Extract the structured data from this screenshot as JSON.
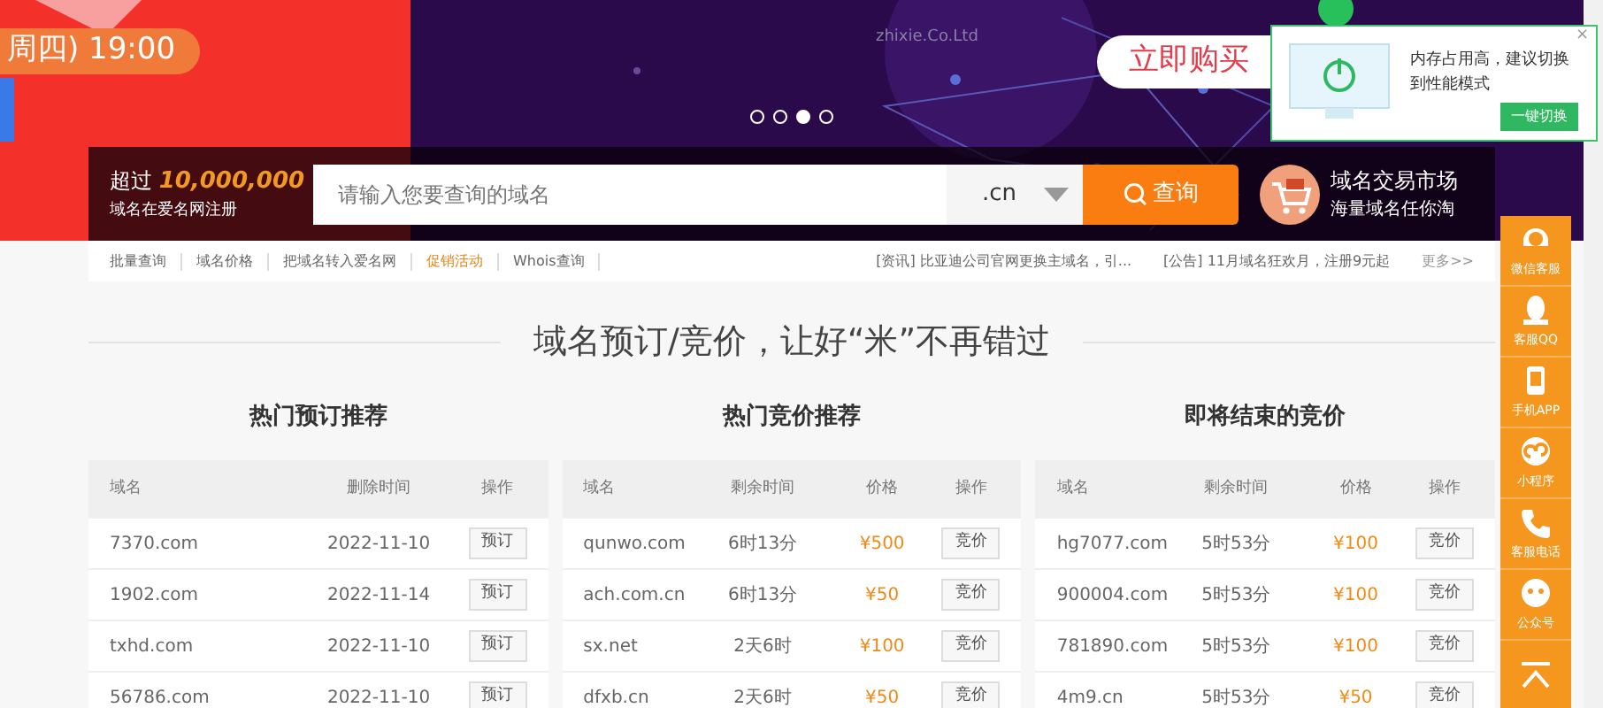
{
  "banner": {
    "promo_time": "周四) 19:00",
    "company": "zhixie.Co.Ltd",
    "buy_button": "立即购买",
    "dots": [
      {
        "selected": false
      },
      {
        "selected": false
      },
      {
        "selected": true
      },
      {
        "selected": false
      }
    ]
  },
  "search": {
    "stat_prefix": "超过",
    "stat_number": "10,000,000",
    "stat_caption": "域名在爱名网注册",
    "placeholder": "请输入您要查询的域名",
    "suffix": ".cn",
    "button": "查询",
    "market_title": "域名交易市场",
    "market_caption": "海量域名任你淘"
  },
  "quick_links": [
    {
      "label": "批量查询",
      "highlight": false
    },
    {
      "label": "域名价格",
      "highlight": false
    },
    {
      "label": "把域名转入爱名网",
      "highlight": false
    },
    {
      "label": "促销活动",
      "highlight": true
    },
    {
      "label": "Whois查询",
      "highlight": false
    }
  ],
  "news": [
    {
      "tag": "[资讯]",
      "text": "比亚迪公司官网更换主域名，引..."
    },
    {
      "tag": "[公告]",
      "text": "11月域名狂欢月，注册9元起"
    }
  ],
  "more": "更多>>",
  "heading": "域名预订/竞价，让好“米”不再错过",
  "tables": [
    {
      "title": "热门预订推荐",
      "columns": [
        "域名",
        "删除时间",
        "操作"
      ],
      "rows": [
        {
          "cells": [
            "7370.com",
            "2022-11-10"
          ],
          "action": "预订"
        },
        {
          "cells": [
            "1902.com",
            "2022-11-14"
          ],
          "action": "预订"
        },
        {
          "cells": [
            "txhd.com",
            "2022-11-10"
          ],
          "action": "预订"
        },
        {
          "cells": [
            "56786.com",
            "2022-11-10"
          ],
          "action": "预订"
        }
      ]
    },
    {
      "title": "热门竞价推荐",
      "columns": [
        "域名",
        "剩余时间",
        "价格",
        "操作"
      ],
      "rows": [
        {
          "cells": [
            "qunwo.com",
            "6时13分",
            "¥500"
          ],
          "action": "竞价"
        },
        {
          "cells": [
            "ach.com.cn",
            "6时13分",
            "¥50"
          ],
          "action": "竞价"
        },
        {
          "cells": [
            "sx.net",
            "2天6时",
            "¥100"
          ],
          "action": "竞价"
        },
        {
          "cells": [
            "dfxb.cn",
            "2天6时",
            "¥50"
          ],
          "action": "竞价"
        }
      ]
    },
    {
      "title": "即将结束的竞价",
      "columns": [
        "域名",
        "剩余时间",
        "价格",
        "操作"
      ],
      "rows": [
        {
          "cells": [
            "hg7077.com",
            "5时53分",
            "¥100"
          ],
          "action": "竞价"
        },
        {
          "cells": [
            "900004.com",
            "5时53分",
            "¥100"
          ],
          "action": "竞价"
        },
        {
          "cells": [
            "781890.com",
            "5时53分",
            "¥100"
          ],
          "action": "竞价"
        },
        {
          "cells": [
            "4m9.cn",
            "5时53分",
            "¥50"
          ],
          "action": "竞价"
        }
      ]
    }
  ],
  "notification": {
    "message": "内存占用高，建议切换到性能模式",
    "button": "一键切换",
    "close": "×"
  },
  "side_toolbar": [
    {
      "kind": "wechat",
      "label": "微信客服"
    },
    {
      "kind": "qq",
      "label": "客服QQ"
    },
    {
      "kind": "app",
      "label": "手机APP"
    },
    {
      "kind": "mini",
      "label": "小程序"
    },
    {
      "kind": "phone",
      "label": "客服电话"
    },
    {
      "kind": "account",
      "label": "公众号"
    },
    {
      "kind": "top"
    }
  ]
}
